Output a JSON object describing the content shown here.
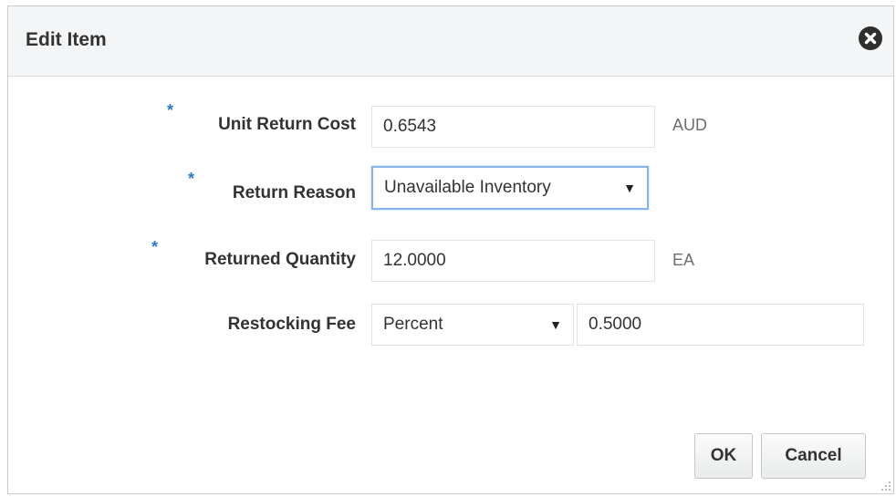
{
  "dialog": {
    "title": "Edit Item",
    "close_icon": "close-circle-icon"
  },
  "form": {
    "required_marker": "*",
    "unit_return_cost": {
      "label": "Unit Return Cost",
      "value": "0.6543",
      "unit": "AUD"
    },
    "return_reason": {
      "label": "Return Reason",
      "selected": "Unavailable Inventory"
    },
    "returned_quantity": {
      "label": "Returned Quantity",
      "value": "12.0000",
      "unit": "EA"
    },
    "restocking_fee": {
      "label": "Restocking Fee",
      "type_selected": "Percent",
      "value": "0.5000"
    }
  },
  "buttons": {
    "ok_label": "OK",
    "cancel_label": "Cancel"
  },
  "colors": {
    "required": "#2c7bc8",
    "focus_border": "#86b3e8",
    "header_bg": "#f4f5f6"
  }
}
